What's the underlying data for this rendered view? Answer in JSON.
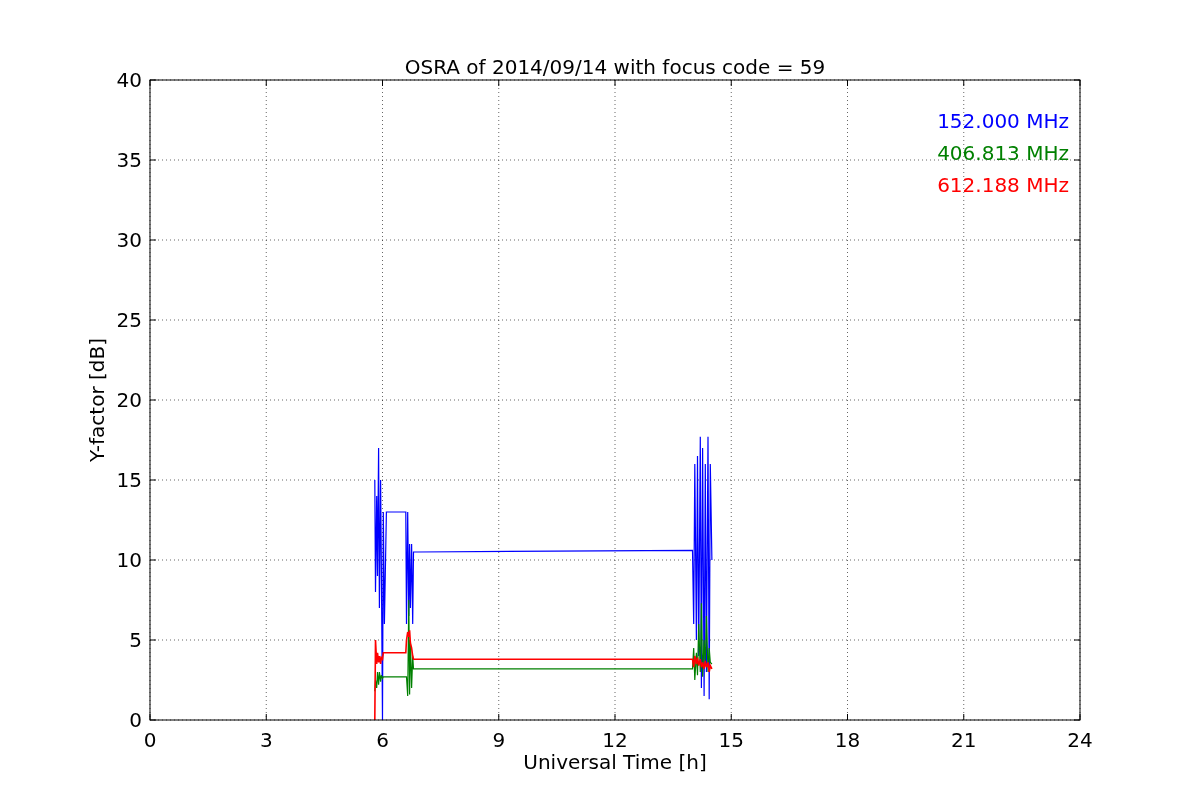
{
  "chart_data": {
    "type": "line",
    "title": "OSRA of 2014/09/14 with focus code = 59",
    "xlabel": "Universal Time [h]",
    "ylabel": "Y-factor [dB]",
    "grid": true,
    "xlim": [
      0,
      24
    ],
    "ylim": [
      0,
      40
    ],
    "xticks": [
      0,
      3,
      6,
      9,
      12,
      15,
      18,
      21,
      24
    ],
    "yticks": [
      0,
      5,
      10,
      15,
      20,
      25,
      30,
      35,
      40
    ],
    "x": [
      5.8,
      5.82,
      5.85,
      5.87,
      5.9,
      5.92,
      5.95,
      5.97,
      6.0,
      6.02,
      6.05,
      6.1,
      6.6,
      6.62,
      6.65,
      6.68,
      6.7,
      6.72,
      6.75,
      6.78,
      6.8,
      6.85,
      6.9,
      14.0,
      14.03,
      14.06,
      14.1,
      14.13,
      14.16,
      14.2,
      14.23,
      14.26,
      14.3,
      14.33,
      14.36,
      14.4,
      14.43,
      14.46,
      14.5
    ],
    "series": [
      {
        "name": "152.000 MHz",
        "color": "#0000ff",
        "values": [
          15,
          8,
          14,
          9,
          17,
          7,
          15,
          10,
          0,
          13,
          6,
          13,
          13,
          6,
          13,
          6.5,
          11,
          7,
          11,
          6,
          10.5,
          10.5,
          10.5,
          10.6,
          6,
          16,
          5,
          16.5,
          4,
          17.7,
          2,
          17,
          1.5,
          16,
          3,
          17.7,
          1.3,
          16,
          10
        ]
      },
      {
        "name": "406.813 MHz",
        "color": "#008000",
        "values": [
          1.8,
          2.5,
          2,
          3,
          2.2,
          3,
          2.4,
          2.8,
          2.6,
          2.7,
          2.7,
          2.7,
          2.7,
          2.7,
          1.5,
          7.5,
          1.6,
          5,
          2,
          4,
          3.2,
          3.2,
          3.2,
          3.2,
          4.5,
          2.5,
          4.2,
          2.8,
          6,
          3,
          7.3,
          2.7,
          5,
          3.5,
          6.5,
          3,
          4.5,
          3.6,
          3.5
        ]
      },
      {
        "name": "612.188 MHz",
        "color": "#ff0000",
        "values": [
          0,
          5,
          3.5,
          4.2,
          3.6,
          4,
          3.5,
          3.9,
          3.8,
          4.2,
          4.2,
          4.2,
          4.2,
          5,
          5.5,
          5.2,
          5.6,
          4.8,
          4.5,
          4,
          3.8,
          3.8,
          3.8,
          3.8,
          3.3,
          4,
          3.5,
          3.9,
          3.4,
          3.8,
          3.3,
          3.6,
          3.2,
          3.7,
          3.3,
          3.6,
          3,
          3.4,
          3.2
        ]
      }
    ]
  }
}
